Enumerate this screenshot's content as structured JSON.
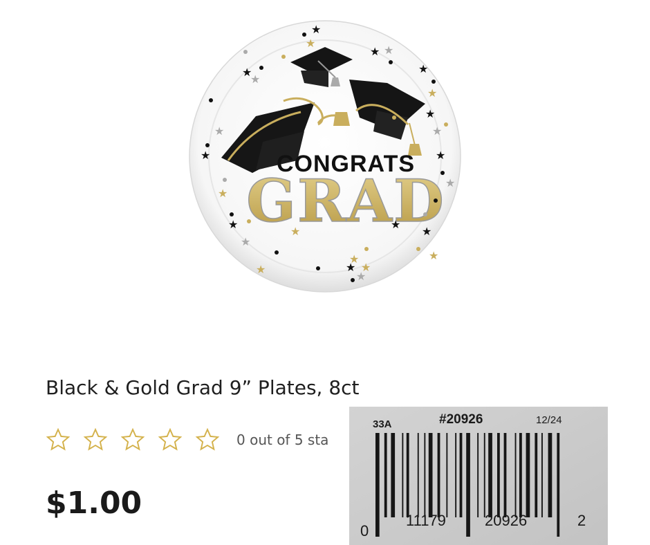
{
  "product": {
    "title": "Black & Gold Grad 9” Plates, 8ct",
    "price": "$1.00",
    "rating": {
      "value": 0,
      "max": 5,
      "text": "0 out of 5 sta"
    },
    "image": {
      "line1": "CONGRATS",
      "line2": "GRAD",
      "icon": "graduation-plate"
    }
  },
  "barcode_label": {
    "code_left": "33A",
    "item_number": "#20926",
    "date": "12/24",
    "digit_left": "0",
    "group1": "11179",
    "group2": "20926",
    "digit_right": "2"
  },
  "colors": {
    "gold": "#c9ae5d",
    "black": "#111111",
    "star_outline": "#d4b24c"
  }
}
